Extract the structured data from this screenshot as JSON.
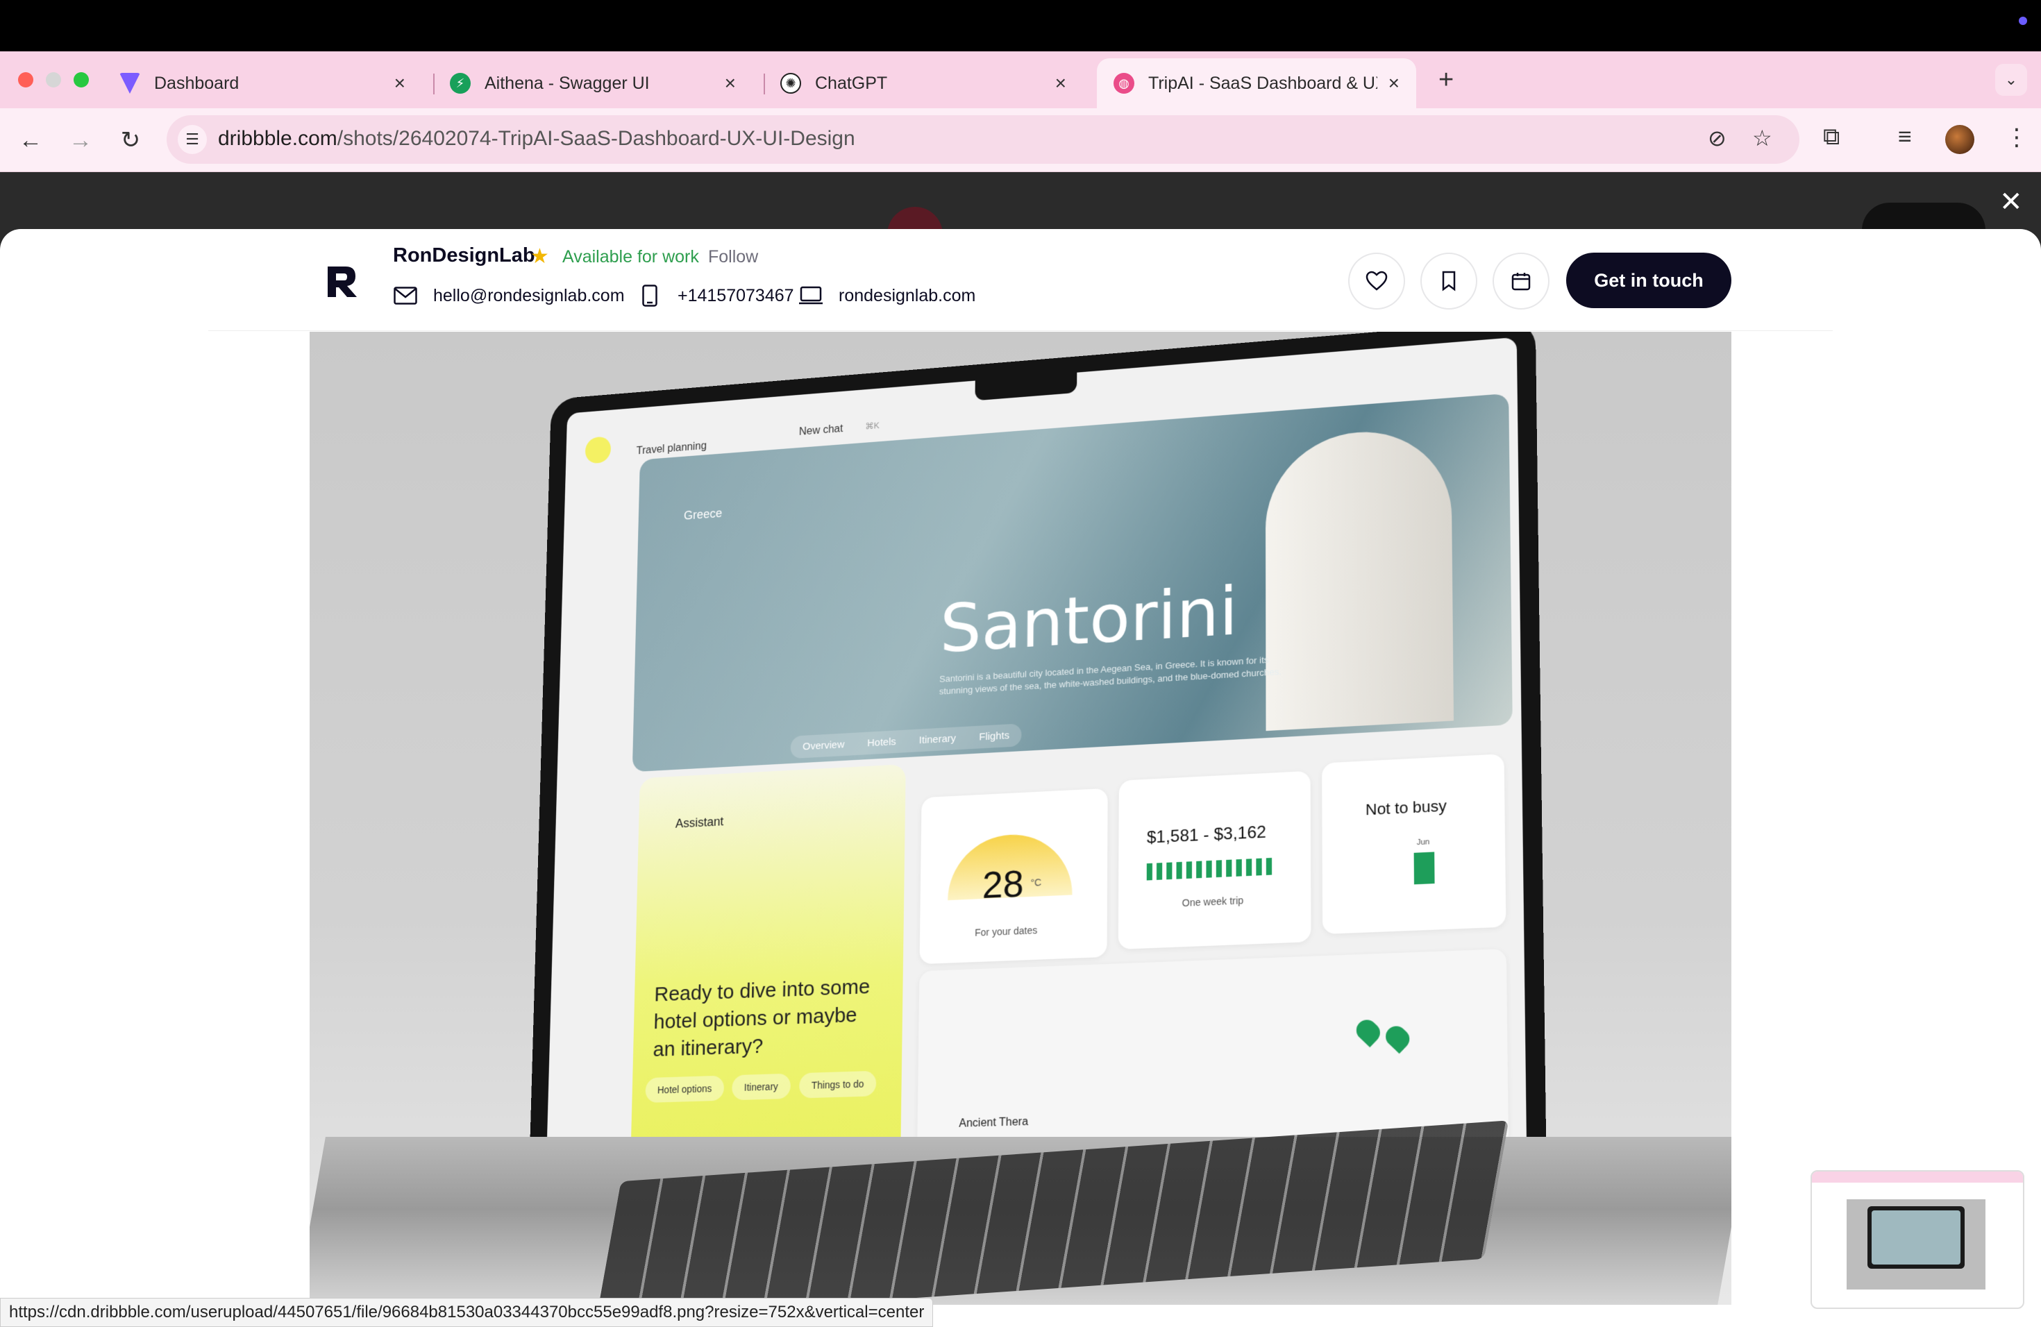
{
  "tabs": [
    {
      "label": "Dashboard",
      "favicon": "vite-icon",
      "color": "#7b5cff"
    },
    {
      "label": "Aithena - Swagger UI",
      "favicon": "swagger-icon",
      "color": "#18a05a"
    },
    {
      "label": "ChatGPT",
      "favicon": "openai-icon",
      "color": "#222222"
    },
    {
      "label": "TripAI - SaaS Dashboard & UX",
      "favicon": "dribbble-icon",
      "color": "#ea4c89"
    }
  ],
  "address": {
    "host": "dribbble.com",
    "path": "/shots/26402074-TripAI-SaaS-Dashboard-UX-UI-Design"
  },
  "designer": {
    "name": "RonDesignLab",
    "available": "Available for work",
    "follow": "Follow",
    "email": "hello@rondesignlab.com",
    "phone": "+14157073467",
    "website": "rondesignlab.com",
    "cta": "Get in touch"
  },
  "shot": {
    "app_tab": "Travel planning",
    "new_chat": "New chat",
    "shortcut": "⌘K",
    "location": "Greece",
    "destination": "Santorini",
    "description": "Santorini is a beautiful city located in the Aegean Sea, in Greece. It is known for its stunning views of the sea, the white-washed buildings, and the blue-domed churches.",
    "nav_tabs": [
      "Overview",
      "Hotels",
      "Itinerary",
      "Flights"
    ],
    "assistant": {
      "title": "Assistant",
      "prompt": "Ready to dive into some hotel options or maybe an itinerary?",
      "chips": [
        "Hotel options",
        "Itinerary",
        "Things to do"
      ]
    },
    "weather": {
      "temp": "28",
      "unit": "°C",
      "caption": "For your dates"
    },
    "price": {
      "range": "$1,581 - $3,162",
      "caption": "One week trip"
    },
    "busy": {
      "label": "Not to busy",
      "month": "Jun"
    },
    "attraction": "Ancient Thera"
  },
  "status_url": "https://cdn.dribbble.com/userupload/44507651/file/96684b81530a03344370bcc55e99adf8.png?resize=752x&vertical=center",
  "colors": {
    "accent": "#0d0c22",
    "available": "#2e9e4e",
    "tabstrip": "#f9d3e6"
  }
}
